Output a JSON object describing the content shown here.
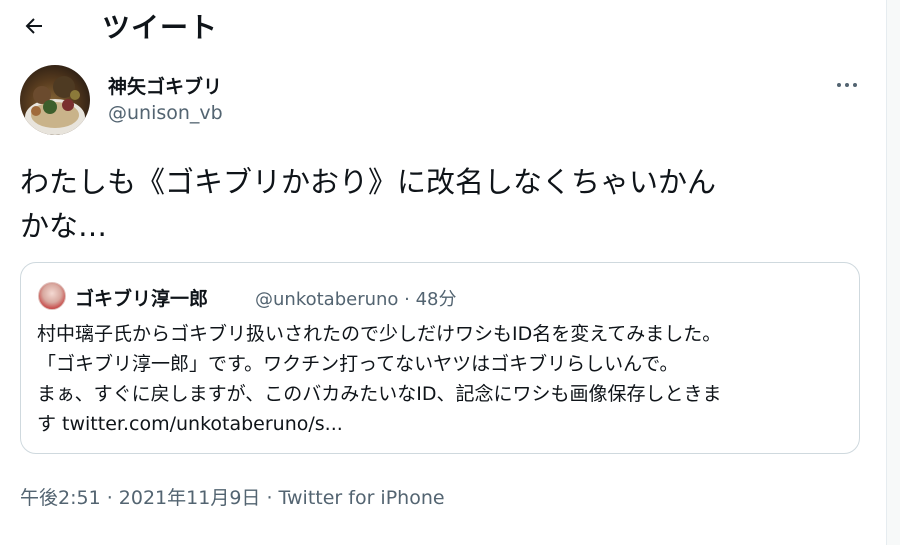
{
  "header": {
    "back_icon": "arrow-left-icon",
    "title": "ツイート"
  },
  "tweet": {
    "author_name": "神矢ゴキブリ",
    "author_handle": "@unison_vb",
    "more_icon": "more-dots-icon",
    "text_line1": "わたしも《ゴキブリかおり》に改名しなくちゃいかん",
    "text_line2": "かな…",
    "quote": {
      "author_name": "ゴキブリ淳一郎",
      "author_meta": "@unkotaberuno · 48分",
      "lines": [
        "村中璃子氏からゴキブリ扱いされたので少しだけワシもID名を変えてみました。",
        "「ゴキブリ淳一郎」です。ワクチン打ってないヤツはゴキブリらしいんで。",
        "まぁ、すぐに戻しますが、このバカみたいなID、記念にワシも画像保存しときま",
        "す twitter.com/unkotaberuno/s..."
      ]
    },
    "time": "午後2:51",
    "separator": " · ",
    "date": "2021年11月9日",
    "source": "Twitter for iPhone"
  }
}
